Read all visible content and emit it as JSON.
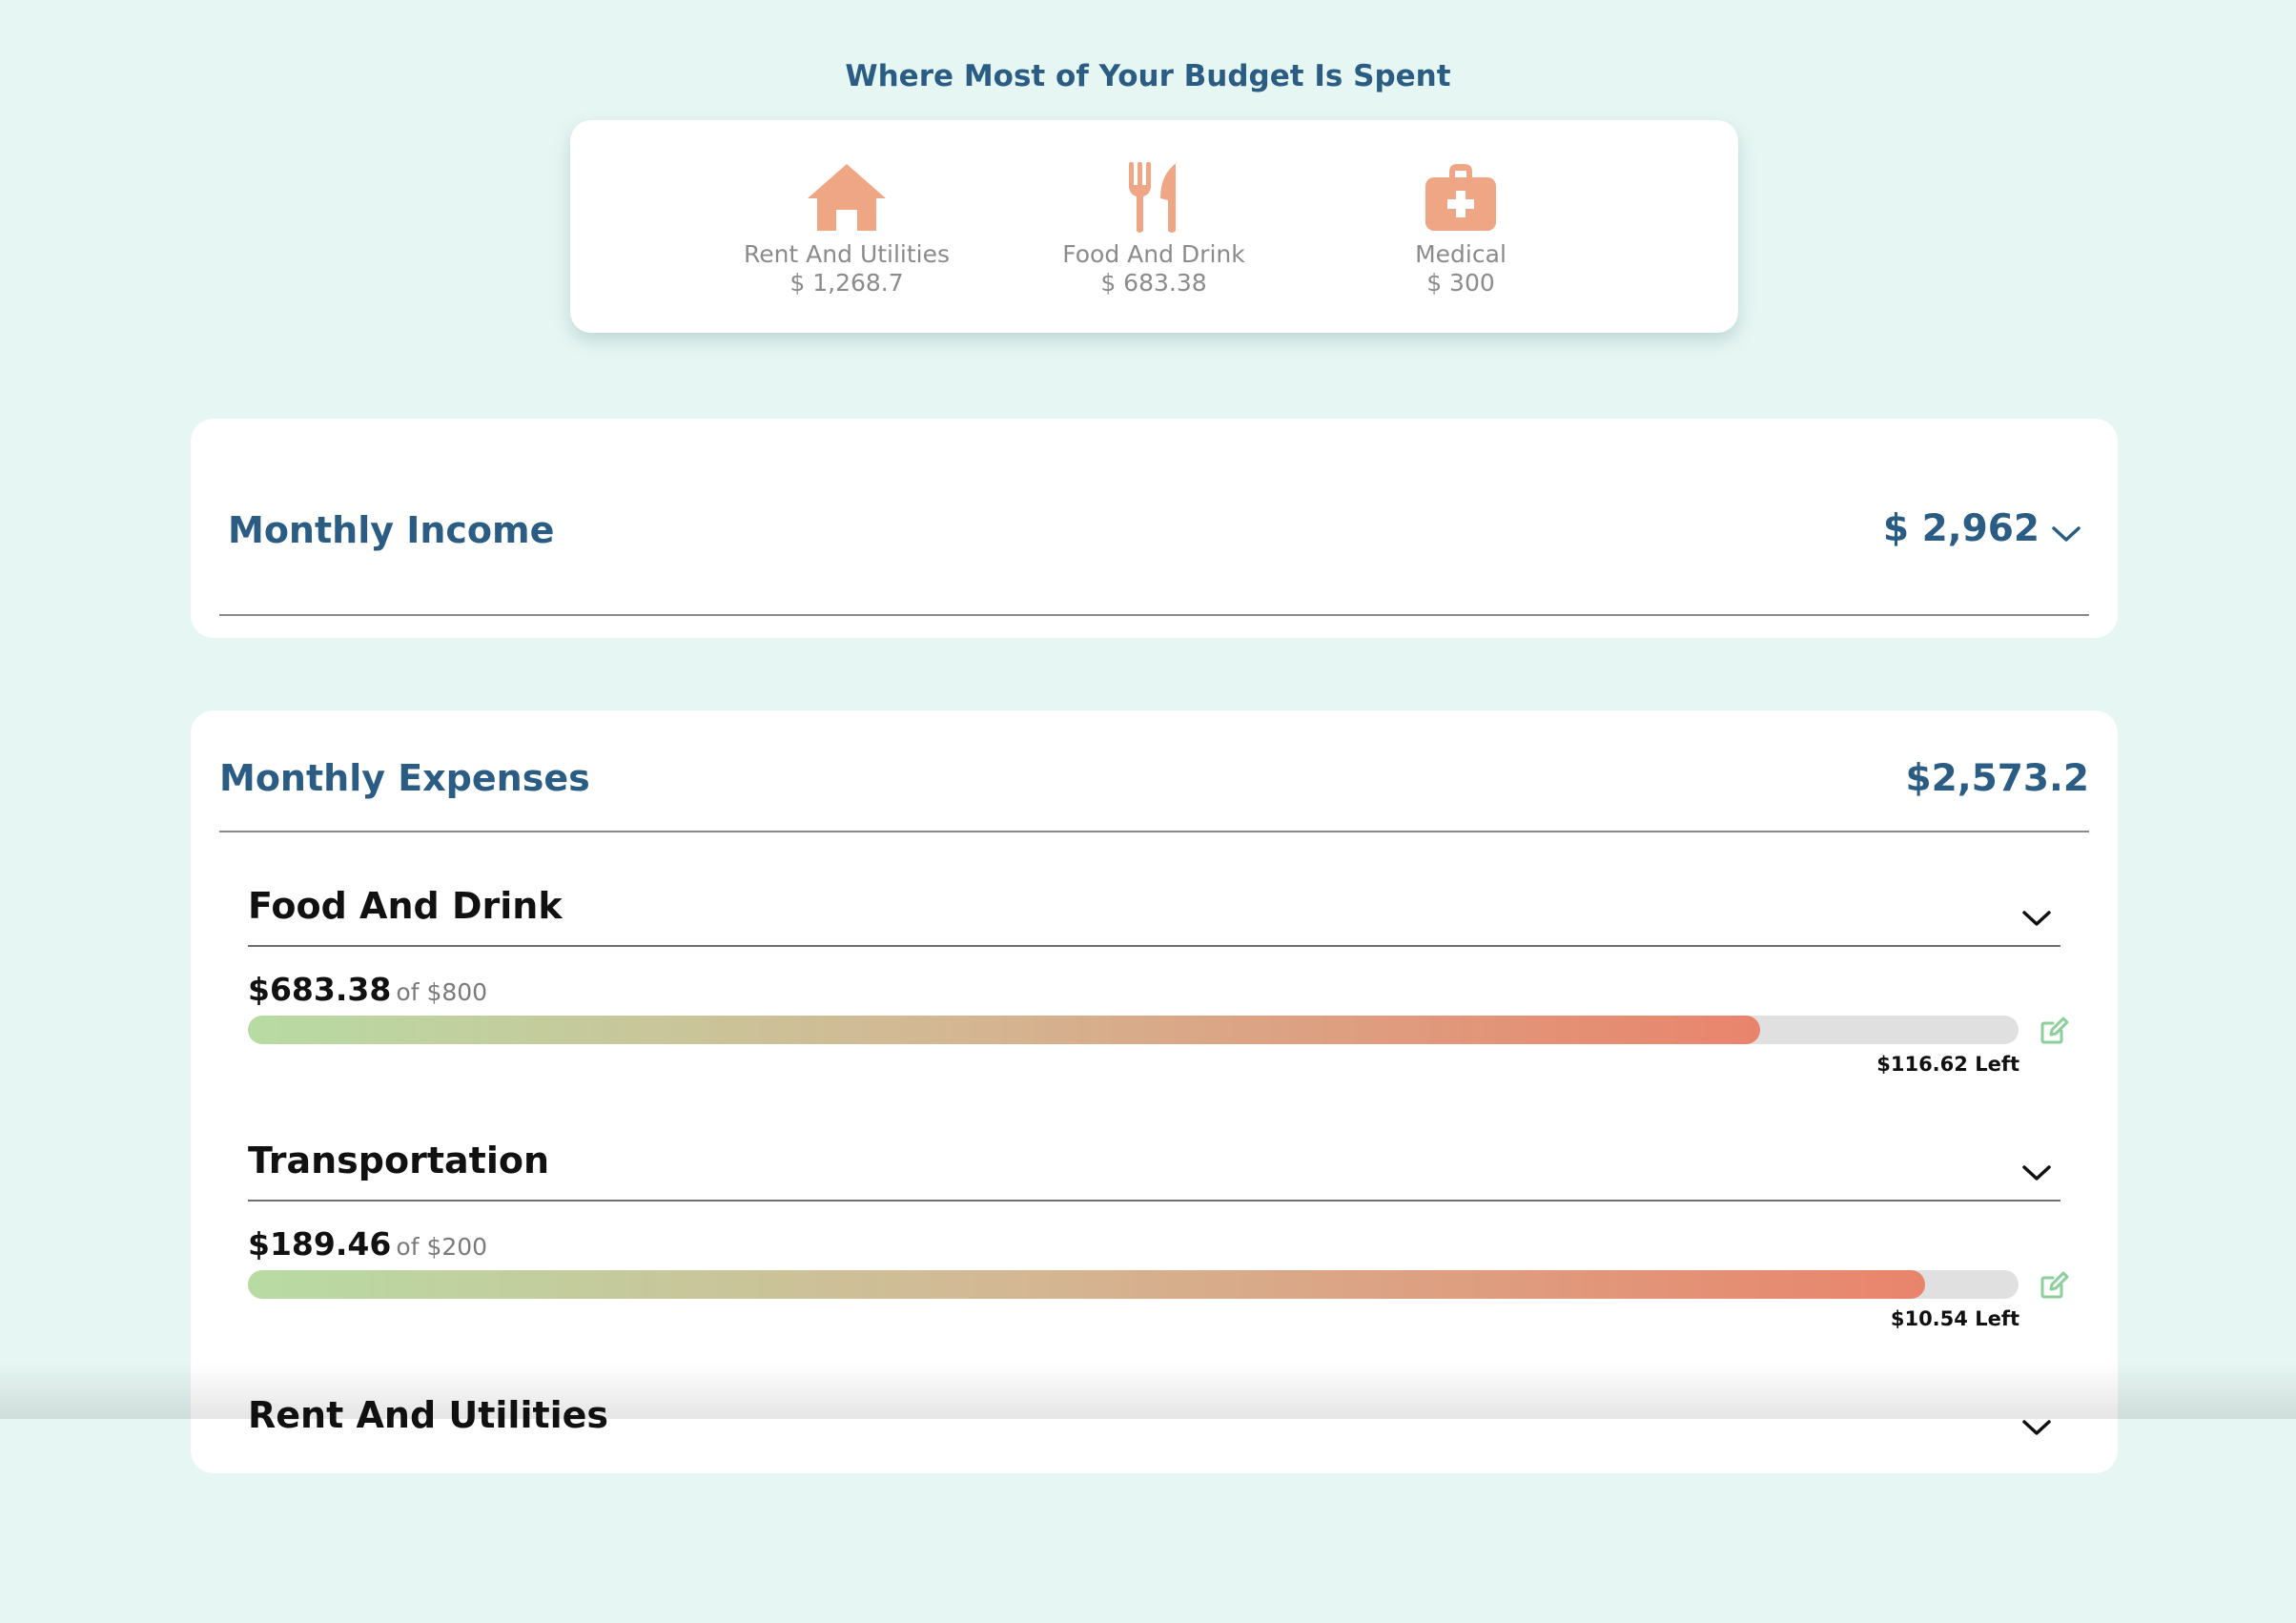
{
  "header": {
    "title": "Where Most of Your Budget Is Spent"
  },
  "top_categories": [
    {
      "icon": "house-icon",
      "name": "Rent And Utilities",
      "amount": "$ 1,268.7"
    },
    {
      "icon": "fork-knife-icon",
      "name": "Food And Drink",
      "amount": "$ 683.38"
    },
    {
      "icon": "medical-kit-icon",
      "name": "Medical",
      "amount": "$ 300"
    }
  ],
  "income": {
    "title": "Monthly Income",
    "amount": "$ 2,962"
  },
  "expenses": {
    "title": "Monthly Expenses",
    "total": "$2,573.2",
    "budgets": [
      {
        "name": "Food And Drink",
        "spent": "$683.38",
        "of_label": "of $800",
        "left_label": "$116.62 Left",
        "progress": 0.854
      },
      {
        "name": "Transportation",
        "spent": "$189.46",
        "of_label": "of $200",
        "left_label": "$10.54 Left",
        "progress": 0.947
      },
      {
        "name": "Rent And Utilities"
      }
    ]
  },
  "colors": {
    "background": "#e6f6f3",
    "heading": "#2a5c84",
    "icon": "#efa685",
    "bar_start": "#b8dba3",
    "bar_end": "#e9846c",
    "edit_icon": "#8dcf9a"
  }
}
